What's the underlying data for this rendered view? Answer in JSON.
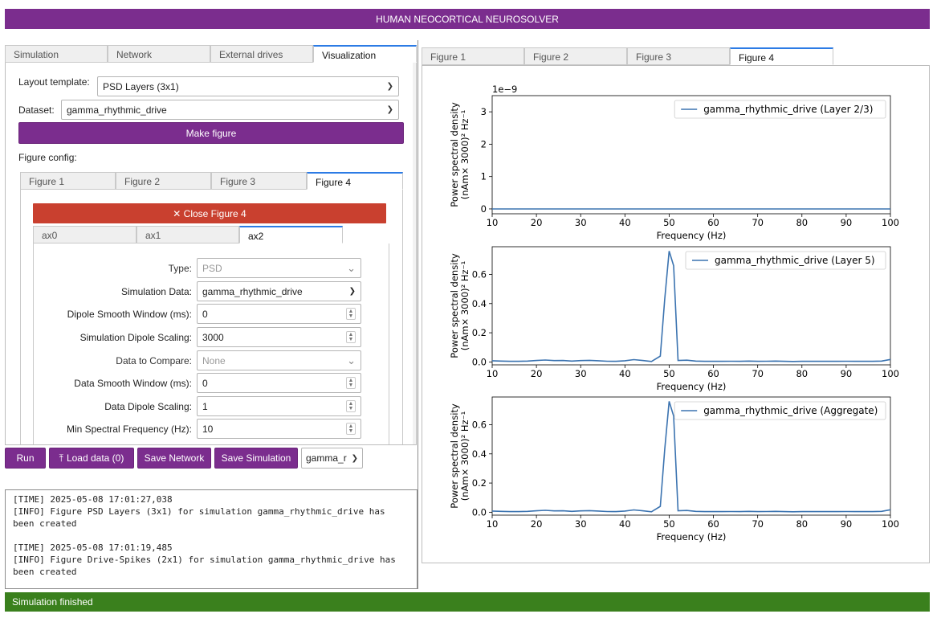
{
  "app": {
    "title": "HUMAN NEOCORTICAL NEUROSOLVER"
  },
  "left_tabs": [
    "Simulation",
    "Network",
    "External drives",
    "Visualization"
  ],
  "visualization": {
    "layout_label": "Layout template:",
    "layout_value": "PSD Layers (3x1)",
    "dataset_label": "Dataset:",
    "dataset_value": "gamma_rhythmic_drive",
    "make_figure": "Make figure",
    "figure_config_label": "Figure config:",
    "figure_tabs": [
      "Figure 1",
      "Figure 2",
      "Figure 3",
      "Figure 4"
    ],
    "close_figure": "✕ Close Figure 4",
    "ax_tabs": [
      "ax0",
      "ax1",
      "ax2"
    ],
    "fields": [
      {
        "label": "Type:",
        "value": "PSD",
        "kind": "select",
        "disabled": true
      },
      {
        "label": "Simulation Data:",
        "value": "gamma_rhythmic_drive",
        "kind": "select",
        "disabled": false
      },
      {
        "label": "Dipole Smooth Window (ms):",
        "value": "0",
        "kind": "number",
        "disabled": false
      },
      {
        "label": "Simulation Dipole Scaling:",
        "value": "3000",
        "kind": "number",
        "disabled": false
      },
      {
        "label": "Data to Compare:",
        "value": "None",
        "kind": "select",
        "disabled": true
      },
      {
        "label": "Data Smooth Window (ms):",
        "value": "0",
        "kind": "number",
        "disabled": false
      },
      {
        "label": "Data Dipole Scaling:",
        "value": "1",
        "kind": "number",
        "disabled": false
      },
      {
        "label": "Min Spectral Frequency (Hz):",
        "value": "10",
        "kind": "number",
        "disabled": false
      }
    ]
  },
  "actions": {
    "run": "Run",
    "load_data": "Load data (0)",
    "save_network": "Save Network",
    "save_simulation": "Save Simulation",
    "sim_select": "gamma_r"
  },
  "log": {
    "lines": [
      "[TIME] 2025-05-08 17:01:27,038",
      "[INFO] Figure PSD Layers (3x1) for simulation gamma_rhythmic_drive has been created",
      "",
      "[TIME] 2025-05-08 17:01:19,485",
      "[INFO] Figure Drive-Spikes (2x1) for simulation gamma_rhythmic_drive has been created"
    ]
  },
  "status": "Simulation finished",
  "right_tabs": [
    "Figure 1",
    "Figure 2",
    "Figure 3",
    "Figure 4"
  ],
  "colors": {
    "brand": "#7b2d8e",
    "close": "#c9402f",
    "status": "#3a801d",
    "line": "#3b73b0",
    "tab_accent": "#2c7be5"
  },
  "chart_data": [
    {
      "type": "line",
      "ylabel_1": "Power spectral density",
      "ylabel_2": "(nAm× 3000)² Hz⁻¹",
      "xlabel": "Frequency (Hz)",
      "offset_text": "1e−9",
      "x_ticks": [
        "10",
        "20",
        "30",
        "40",
        "50",
        "60",
        "70",
        "80",
        "90",
        "100"
      ],
      "y_ticks": [
        "0",
        "1",
        "2",
        "3"
      ],
      "xlim": [
        10,
        100
      ],
      "ylim": [
        -0.15,
        3.5
      ],
      "series": [
        {
          "name": "gamma_rhythmic_drive (Layer 2/3)",
          "x": [
            10,
            100
          ],
          "y": [
            0,
            0
          ]
        }
      ]
    },
    {
      "type": "line",
      "ylabel_1": "Power spectral density",
      "ylabel_2": "(nAm× 3000)² Hz⁻¹",
      "xlabel": "Frequency (Hz)",
      "x_ticks": [
        "10",
        "20",
        "30",
        "40",
        "50",
        "60",
        "70",
        "80",
        "90",
        "100"
      ],
      "y_ticks": [
        "0.0",
        "0.2",
        "0.4",
        "0.6"
      ],
      "xlim": [
        10,
        100
      ],
      "ylim": [
        -0.02,
        0.79
      ],
      "series": [
        {
          "name": "gamma_rhythmic_drive (Layer 5)",
          "x": [
            10,
            12,
            14,
            16,
            18,
            20,
            22,
            24,
            26,
            28,
            30,
            32,
            34,
            36,
            38,
            40,
            42,
            44,
            46,
            48,
            49,
            50,
            51,
            52,
            54,
            56,
            58,
            60,
            62,
            64,
            66,
            68,
            70,
            72,
            74,
            76,
            78,
            80,
            82,
            84,
            86,
            88,
            90,
            92,
            94,
            96,
            98,
            100
          ],
          "y": [
            0.008,
            0.006,
            0.004,
            0.004,
            0.006,
            0.01,
            0.013,
            0.009,
            0.01,
            0.006,
            0.009,
            0.011,
            0.008,
            0.005,
            0.004,
            0.008,
            0.016,
            0.01,
            0.003,
            0.04,
            0.43,
            0.76,
            0.66,
            0.01,
            0.012,
            0.006,
            0.004,
            0.004,
            0.004,
            0.005,
            0.004,
            0.006,
            0.004,
            0.005,
            0.006,
            0.004,
            0.003,
            0.004,
            0.004,
            0.004,
            0.004,
            0.004,
            0.005,
            0.004,
            0.004,
            0.004,
            0.006,
            0.017
          ]
        }
      ]
    },
    {
      "type": "line",
      "ylabel_1": "Power spectral density",
      "ylabel_2": "(nAm× 3000)² Hz⁻¹",
      "xlabel": "Frequency (Hz)",
      "x_ticks": [
        "10",
        "20",
        "30",
        "40",
        "50",
        "60",
        "70",
        "80",
        "90",
        "100"
      ],
      "y_ticks": [
        "0.0",
        "0.2",
        "0.4",
        "0.6"
      ],
      "xlim": [
        10,
        100
      ],
      "ylim": [
        -0.02,
        0.79
      ],
      "series": [
        {
          "name": "gamma_rhythmic_drive (Aggregate)",
          "x": [
            10,
            12,
            14,
            16,
            18,
            20,
            22,
            24,
            26,
            28,
            30,
            32,
            34,
            36,
            38,
            40,
            42,
            44,
            46,
            48,
            49,
            50,
            51,
            52,
            54,
            56,
            58,
            60,
            62,
            64,
            66,
            68,
            70,
            72,
            74,
            76,
            78,
            80,
            82,
            84,
            86,
            88,
            90,
            92,
            94,
            96,
            98,
            100
          ],
          "y": [
            0.008,
            0.006,
            0.004,
            0.004,
            0.006,
            0.01,
            0.013,
            0.009,
            0.01,
            0.006,
            0.009,
            0.011,
            0.008,
            0.005,
            0.004,
            0.008,
            0.016,
            0.01,
            0.003,
            0.04,
            0.43,
            0.76,
            0.66,
            0.01,
            0.012,
            0.006,
            0.004,
            0.004,
            0.004,
            0.005,
            0.004,
            0.006,
            0.004,
            0.005,
            0.006,
            0.004,
            0.003,
            0.004,
            0.004,
            0.004,
            0.004,
            0.004,
            0.005,
            0.004,
            0.004,
            0.004,
            0.006,
            0.017
          ]
        }
      ]
    }
  ]
}
